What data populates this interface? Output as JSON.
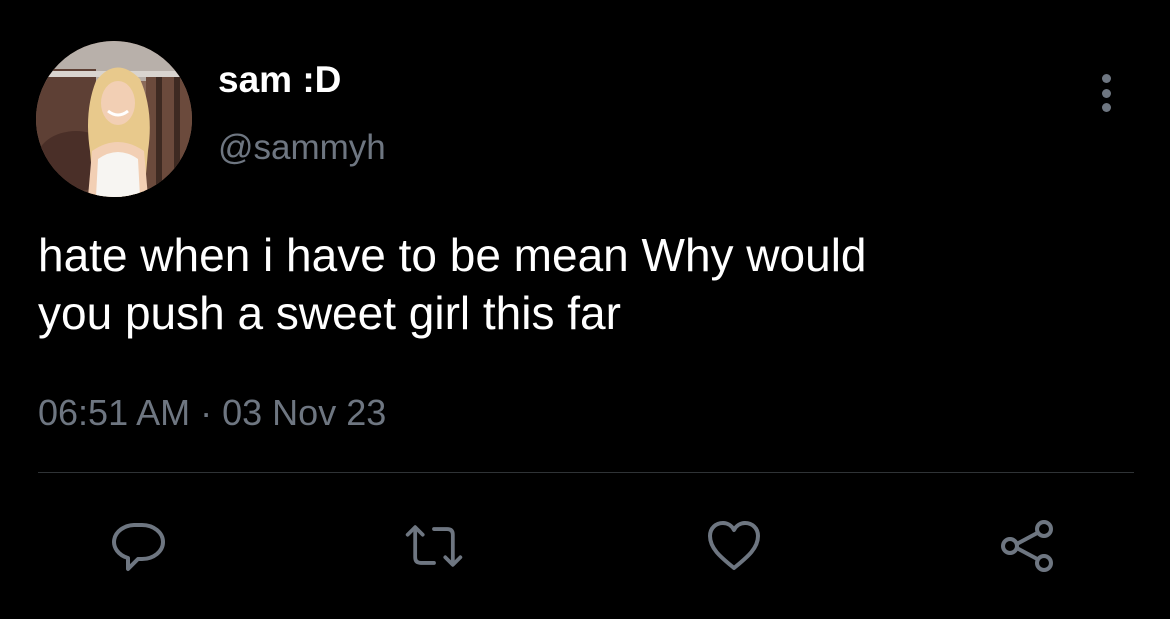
{
  "tweet": {
    "display_name": "sam :D",
    "handle": "@sammyh",
    "text_lines": [
      "hate when i have to be mean Why would",
      "you push a sweet girl this far"
    ],
    "time": "06:51 AM",
    "separator": "·",
    "date": "03 Nov 23"
  },
  "icons": {
    "avatar": "profile-photo",
    "more": "more-vertical-icon",
    "reply": "reply-bubble-icon",
    "retweet": "retweet-icon",
    "like": "heart-icon",
    "share": "share-nodes-icon"
  },
  "colors": {
    "background": "#000000",
    "primary_text": "#ffffff",
    "secondary_text": "#6e7681",
    "divider": "#2f3336"
  }
}
